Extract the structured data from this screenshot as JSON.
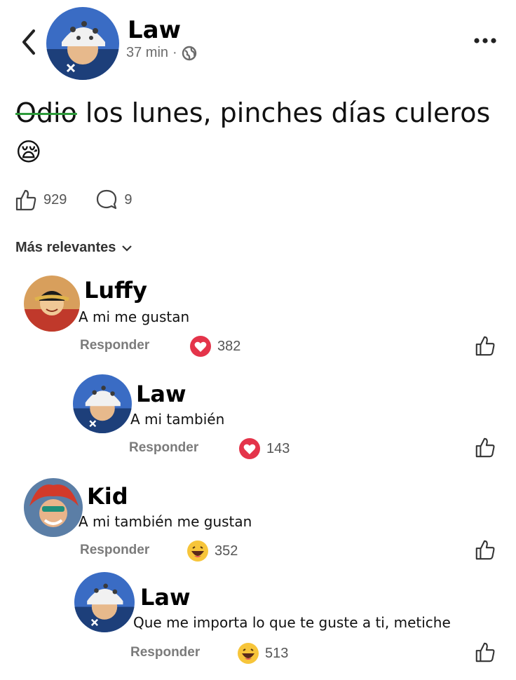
{
  "post": {
    "author": "Law",
    "time": "37 min",
    "separator": "·",
    "text_struck": "Odio",
    "text": " los lunes, pinches días culeros",
    "emoji": "😪",
    "likes": "929",
    "comments": "9"
  },
  "sort_label": "Más relevantes",
  "reply_label": "Responder",
  "comments": [
    {
      "author": "Luffy",
      "text": "A mi me gustan",
      "reaction_count": "382",
      "reaction": "heart"
    },
    {
      "author": "Law",
      "text": "A mi también",
      "reaction_count": "143",
      "reaction": "heart"
    },
    {
      "author": "Kid",
      "text": "A mi también me gustan",
      "reaction_count": "352",
      "reaction": "laugh"
    },
    {
      "author": "Law",
      "text": "Que me importa lo que te guste a ti, metiche",
      "reaction_count": "513",
      "reaction": "laugh"
    }
  ],
  "colors": {
    "strike": "#2d9b3a",
    "heart": "#e4344a",
    "laugh": "#f7c53a"
  }
}
